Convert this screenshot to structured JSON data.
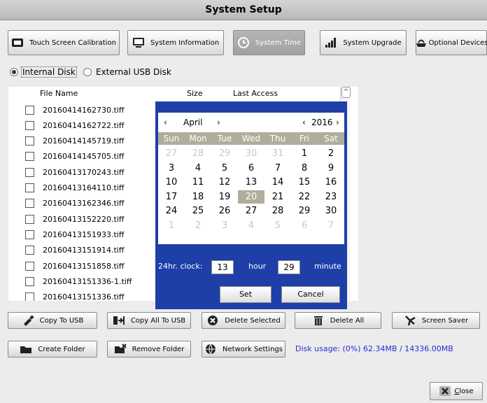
{
  "window": {
    "title": "System Setup"
  },
  "toolbar": {
    "touch": "Touch Screen Calibration",
    "info": "System Information",
    "time": "System Time",
    "upgrade": "System Upgrade",
    "optional": "Optional Devices"
  },
  "storage": {
    "internal": "Internal Disk",
    "external": "External USB Disk",
    "selected": "Internal Disk"
  },
  "files": {
    "headers": {
      "name": "File Name",
      "size": "Size",
      "access": "Last Access"
    },
    "items": [
      "20160414162730.tiff",
      "20160414162722.tiff",
      "20160414145719.tiff",
      "20160414145705.tiff",
      "20160413170243.tiff",
      "20160413164110.tiff",
      "20160413162346.tiff",
      "20160413152220.tiff",
      "20160413151933.tiff",
      "20160413151914.tiff",
      "20160413151858.tiff",
      "20160413151336-1.tiff",
      "20160413151336.tiff"
    ]
  },
  "calendar": {
    "month": "April",
    "year": "2016",
    "prev": "‹",
    "next": "›",
    "days_of_week": [
      "Sun",
      "Mon",
      "Tue",
      "Wed",
      "Thu",
      "Fri",
      "Sat"
    ],
    "weeks": [
      [
        "27",
        "28",
        "29",
        "30",
        "31",
        "1",
        "2"
      ],
      [
        "3",
        "4",
        "5",
        "6",
        "7",
        "8",
        "9"
      ],
      [
        "10",
        "11",
        "12",
        "13",
        "14",
        "15",
        "16"
      ],
      [
        "17",
        "18",
        "19",
        "20",
        "21",
        "22",
        "23"
      ],
      [
        "24",
        "25",
        "26",
        "27",
        "28",
        "29",
        "30"
      ],
      [
        "1",
        "2",
        "3",
        "4",
        "5",
        "6",
        "7"
      ]
    ],
    "selected_day": "20",
    "clock_label": "24hr. clock:",
    "hour": "13",
    "hour_label": "hour",
    "minute": "29",
    "minute_label": "minute",
    "set": "Set",
    "cancel": "Cancel"
  },
  "actions": {
    "copy_usb": "Copy To USB",
    "copy_all": "Copy All To USB",
    "delete_selected": "Delete Selected",
    "delete_all": "Delete All",
    "screen_saver": "Screen Saver",
    "create_folder": "Create Folder",
    "remove_folder": "Remove Folder",
    "network": "Network Settings"
  },
  "disk_usage": "Disk usage: (0%) 62.34MB / 14336.00MB",
  "close": {
    "label_underlined": "C",
    "label_rest": "lose"
  },
  "icons": [
    "monitor-icon",
    "info-monitor-icon",
    "clock-icon",
    "signal-bars-icon",
    "devices-icon",
    "usb-stick-icon",
    "copy-all-icon",
    "x-circle-icon",
    "trash-icon",
    "fan-icon",
    "folder-icon",
    "remove-folder-icon",
    "globe-icon",
    "close-x-icon"
  ],
  "colors": {
    "calendar_bg": "#1e3fa8",
    "selected_day": "#b1ad9c",
    "disk_text": "#2a2ad0"
  }
}
